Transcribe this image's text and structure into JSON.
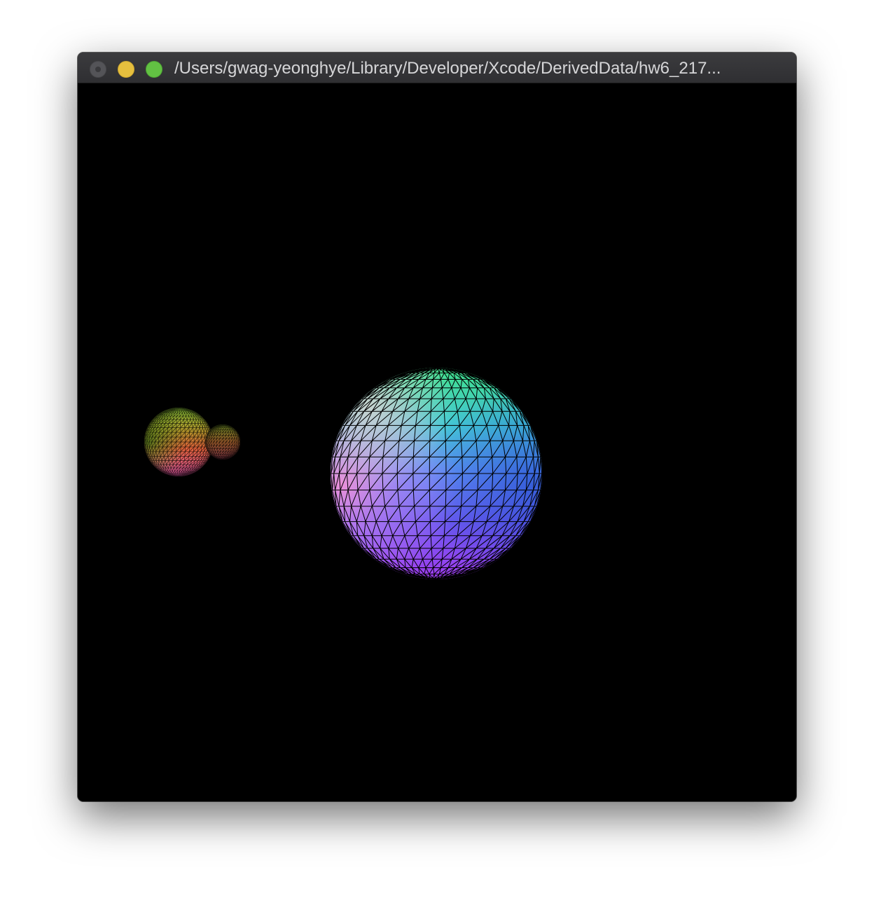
{
  "window": {
    "title": "/Users/gwag-yeonghye/Library/Developer/Xcode/DerivedData/hw6_217...",
    "buttons": {
      "close": "close",
      "minimize": "minimize",
      "maximize": "maximize"
    },
    "colors": {
      "titlebar": "#343437",
      "close": "#545458",
      "minimize": "#e6bf3e",
      "maximize": "#62c143",
      "background": "#000000"
    }
  },
  "scene": {
    "objects": [
      {
        "name": "large-sphere",
        "color_top": "#3fd88a",
        "color_center": "#5f8ef5",
        "color_bottom": "#9a3cf0",
        "color_left": "#f07ac8",
        "rendering": "wireframe-shaded"
      },
      {
        "name": "medium-sphere",
        "color_top": "#7fc23a",
        "color_center": "#e0603a",
        "color_bottom": "#e05a9a",
        "rendering": "wireframe-shaded"
      },
      {
        "name": "small-sphere",
        "color_top": "#6a8a2a",
        "color_center": "#9a4a2a",
        "rendering": "wireframe-shaded"
      }
    ]
  }
}
